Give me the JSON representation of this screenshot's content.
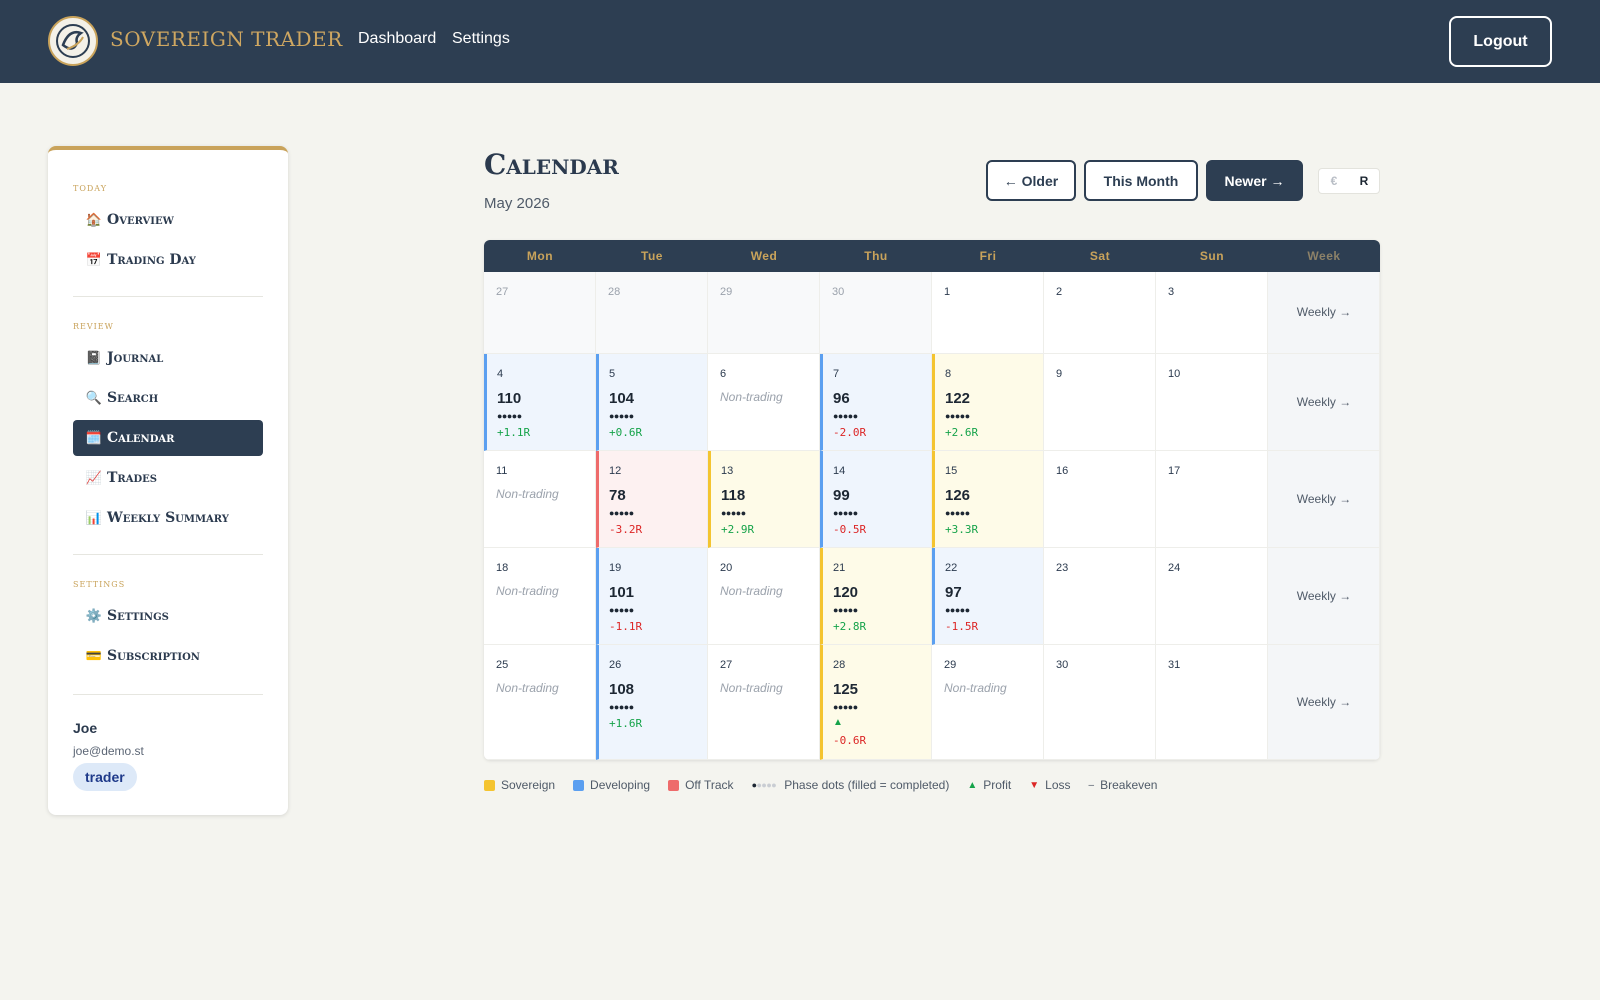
{
  "header": {
    "brand": "SOVEREIGN TRADER",
    "nav": [
      "Dashboard",
      "Settings"
    ],
    "logout_label": "Logout"
  },
  "sidebar": {
    "sections": [
      {
        "title": "Today",
        "items": [
          {
            "icon": "🏠",
            "label": "Overview"
          },
          {
            "icon": "📅",
            "label": "Trading Day"
          }
        ]
      },
      {
        "title": "Review",
        "items": [
          {
            "icon": "📓",
            "label": "Journal"
          },
          {
            "icon": "🔍",
            "label": "Search"
          },
          {
            "icon": "🗓️",
            "label": "Calendar",
            "active": true
          },
          {
            "icon": "📈",
            "label": "Trades"
          },
          {
            "icon": "📊",
            "label": "Weekly Summary"
          }
        ]
      },
      {
        "title": "Settings",
        "items": [
          {
            "icon": "⚙️",
            "label": "Settings"
          },
          {
            "icon": "💳",
            "label": "Subscription"
          }
        ]
      }
    ],
    "user": {
      "name": "Joe",
      "email": "joe@demo.st",
      "role": "trader"
    }
  },
  "main": {
    "title": "Calendar",
    "subtitle": "May 2026",
    "buttons": {
      "older": "← Older",
      "this_month": "This Month",
      "newer": "Newer →"
    },
    "currency_toggle": {
      "options": [
        "€",
        "R"
      ],
      "selected": "R"
    }
  },
  "calendar": {
    "headers": [
      "Mon",
      "Tue",
      "Wed",
      "Thu",
      "Fri",
      "Sat",
      "Sun",
      "Week"
    ],
    "weekly_label": "Weekly →",
    "non_trading_label": "Non-trading",
    "weeks": [
      [
        {
          "day": "27",
          "other": true
        },
        {
          "day": "28",
          "other": true
        },
        {
          "day": "29",
          "other": true
        },
        {
          "day": "30",
          "other": true
        },
        {
          "day": "1"
        },
        {
          "day": "2"
        },
        {
          "day": "3"
        }
      ],
      [
        {
          "day": "4",
          "status": "dev",
          "score": "110",
          "dots": 5,
          "r": "+1.1R"
        },
        {
          "day": "5",
          "status": "dev",
          "score": "104",
          "dots": 5,
          "r": "+0.6R"
        },
        {
          "day": "6",
          "nontrading": true
        },
        {
          "day": "7",
          "status": "dev",
          "score": "96",
          "dots": 5,
          "r": "-2.0R"
        },
        {
          "day": "8",
          "status": "sov",
          "score": "122",
          "dots": 5,
          "r": "+2.6R"
        },
        {
          "day": "9"
        },
        {
          "day": "10"
        }
      ],
      [
        {
          "day": "11",
          "nontrading": true
        },
        {
          "day": "12",
          "status": "off",
          "score": "78",
          "dots": 5,
          "r": "-3.2R"
        },
        {
          "day": "13",
          "status": "sov",
          "score": "118",
          "dots": 5,
          "r": "+2.9R"
        },
        {
          "day": "14",
          "status": "dev",
          "score": "99",
          "dots": 5,
          "r": "-0.5R"
        },
        {
          "day": "15",
          "status": "sov",
          "score": "126",
          "dots": 5,
          "r": "+3.3R"
        },
        {
          "day": "16"
        },
        {
          "day": "17"
        }
      ],
      [
        {
          "day": "18",
          "nontrading": true
        },
        {
          "day": "19",
          "status": "dev",
          "score": "101",
          "dots": 5,
          "r": "-1.1R"
        },
        {
          "day": "20",
          "nontrading": true
        },
        {
          "day": "21",
          "status": "sov",
          "score": "120",
          "dots": 5,
          "r": "+2.8R"
        },
        {
          "day": "22",
          "status": "dev",
          "score": "97",
          "dots": 5,
          "r": "-1.5R"
        },
        {
          "day": "23"
        },
        {
          "day": "24"
        }
      ],
      [
        {
          "day": "25",
          "nontrading": true
        },
        {
          "day": "26",
          "status": "dev",
          "score": "108",
          "dots": 5,
          "r": "+1.6R"
        },
        {
          "day": "27",
          "nontrading": true
        },
        {
          "day": "28",
          "status": "sov",
          "score": "125",
          "dots": 5,
          "marker": "▲",
          "r": "-0.6R"
        },
        {
          "day": "29",
          "nontrading": true
        },
        {
          "day": "30"
        },
        {
          "day": "31"
        }
      ]
    ]
  },
  "legend": {
    "sovereign": "Sovereign",
    "developing": "Developing",
    "off_track": "Off Track",
    "phase_dots": "Phase dots (filled = completed)",
    "profit": "Profit",
    "loss": "Loss",
    "breakeven": "Breakeven",
    "profit_marker": "▲",
    "loss_marker": "▼",
    "breakeven_marker": "–"
  },
  "colors": {
    "sovereign": "#f4c430",
    "developing": "#5b9ff0",
    "off_track": "#ee6b6b",
    "accent_gold": "#c9a35b",
    "navy": "#2d3e52",
    "profit": "#16a34a",
    "loss": "#dc2626"
  }
}
